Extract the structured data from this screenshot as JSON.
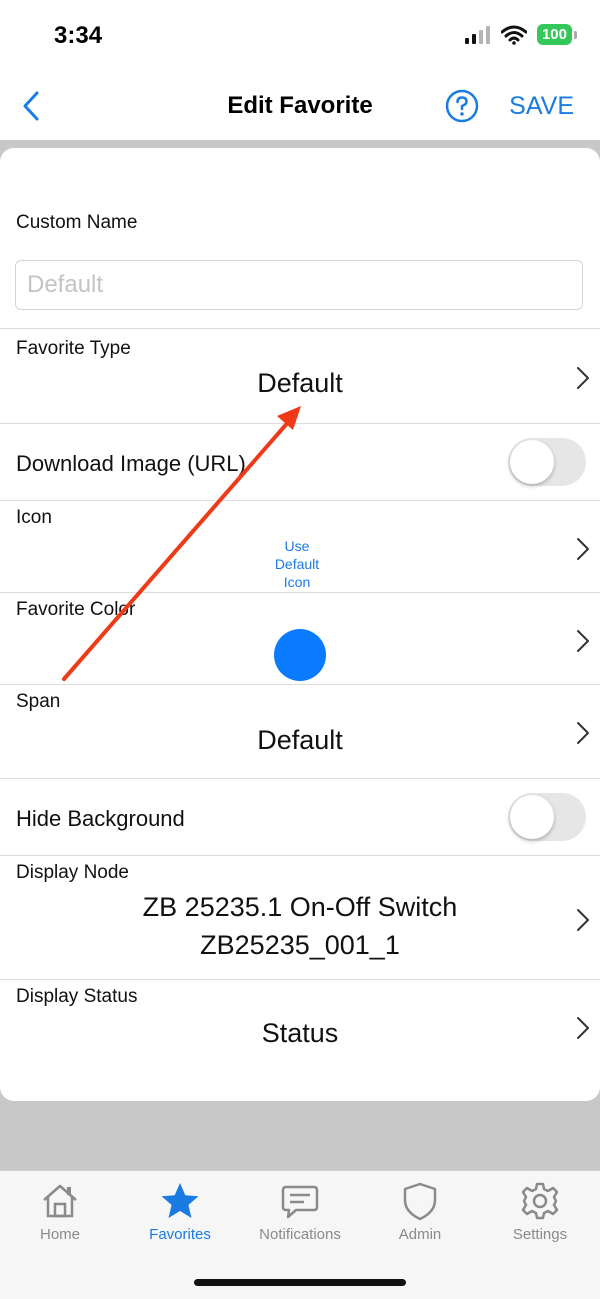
{
  "status_bar": {
    "time": "3:34",
    "battery": "100"
  },
  "nav": {
    "title": "Edit Favorite",
    "save_label": "SAVE"
  },
  "form": {
    "custom_name": {
      "label": "Custom Name",
      "placeholder": "Default",
      "value": ""
    },
    "favorite_type": {
      "label": "Favorite Type",
      "value": "Default"
    },
    "download_image": {
      "label": "Download Image (URL)",
      "enabled": false
    },
    "icon": {
      "label": "Icon",
      "value_lines": [
        "Use",
        "Default",
        "Icon"
      ]
    },
    "favorite_color": {
      "label": "Favorite Color",
      "color": "#0a7aff"
    },
    "span": {
      "label": "Span",
      "value": "Default"
    },
    "hide_background": {
      "label": "Hide Background",
      "enabled": false
    },
    "display_node": {
      "label": "Display Node",
      "value_lines": [
        "ZB 25235.1 On-Off Switch",
        "ZB25235_001_1"
      ]
    },
    "display_status": {
      "label": "Display Status",
      "value": "Status"
    }
  },
  "tabs": [
    {
      "label": "Home",
      "icon": "home-icon",
      "active": false
    },
    {
      "label": "Favorites",
      "icon": "star-icon",
      "active": true
    },
    {
      "label": "Notifications",
      "icon": "chat-bubble-icon",
      "active": false
    },
    {
      "label": "Admin",
      "icon": "shield-icon",
      "active": false
    },
    {
      "label": "Settings",
      "icon": "gear-icon",
      "active": false
    }
  ],
  "colors": {
    "accent": "#1a7be3",
    "annotation_arrow": "#f03a17"
  }
}
